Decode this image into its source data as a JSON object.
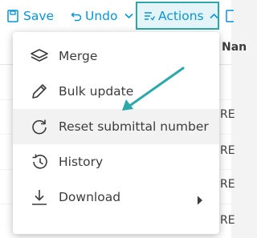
{
  "toolbar": {
    "save_label": "Save",
    "undo_label": "Undo",
    "actions_label": "Actions"
  },
  "table": {
    "column_header": "Nan",
    "row_cell_text": "RE"
  },
  "actions_menu": {
    "items": [
      {
        "label": "Merge",
        "icon": "layers-icon"
      },
      {
        "label": "Bulk update",
        "icon": "pencil-icon"
      },
      {
        "label": "Reset submittal number",
        "icon": "reset-icon"
      },
      {
        "label": "History",
        "icon": "history-icon"
      },
      {
        "label": "Download",
        "icon": "download-icon",
        "has_submenu": true
      }
    ],
    "highlighted_item": "Reset submittal number"
  },
  "colors": {
    "toolbar_text": "#0696d7",
    "actions_border": "#2ca8a8",
    "annotation_arrow": "#2ca8a8",
    "menu_text": "#3c3c3c",
    "menu_hover": "#f2f2f2"
  }
}
